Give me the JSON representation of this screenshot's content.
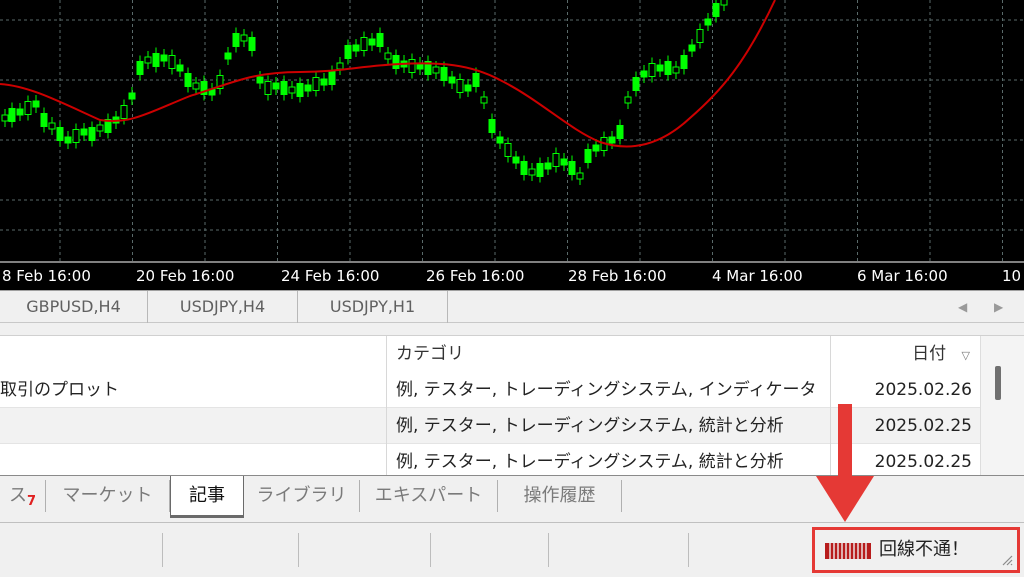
{
  "chart": {
    "time_labels": [
      "8 Feb 16:00",
      "20 Feb 16:00",
      "24 Feb 16:00",
      "26 Feb 16:00",
      "28 Feb 16:00",
      "4 Mar 16:00",
      "6 Mar 16:00",
      "10"
    ],
    "colors": {
      "background": "#000000",
      "grid": "#5a6a6a",
      "candle": "#00ff00",
      "moving_average": "#cc0000",
      "axis_text": "#ffffff"
    }
  },
  "chart_tabs": [
    "GBPUSD,H4",
    "USDJPY,H4",
    "USDJPY,H1"
  ],
  "table": {
    "headers": {
      "title": "",
      "category": "カテゴリ",
      "date": "日付"
    },
    "rows": [
      {
        "title": "取引のプロット",
        "category": "例, テスター, トレーディングシステム, インディケータ",
        "date": "2025.02.26"
      },
      {
        "title": "",
        "category": "例, テスター, トレーディングシステム, 統計と分析",
        "date": "2025.02.25"
      },
      {
        "title": "",
        "category": "例, テスター, トレーディングシステム, 統計と分析",
        "date": "2025.02.25"
      }
    ]
  },
  "terminal_tabs": [
    {
      "label": "ス",
      "badge": "7"
    },
    {
      "label": "マーケット"
    },
    {
      "label": "記事",
      "active": true
    },
    {
      "label": "ライブラリ"
    },
    {
      "label": "エキスパート"
    },
    {
      "label": "操作履歴"
    }
  ],
  "status": {
    "connection_text": "回線不通！",
    "connection_icon": "connection-bars-icon",
    "highlight_color": "#e53935"
  }
}
